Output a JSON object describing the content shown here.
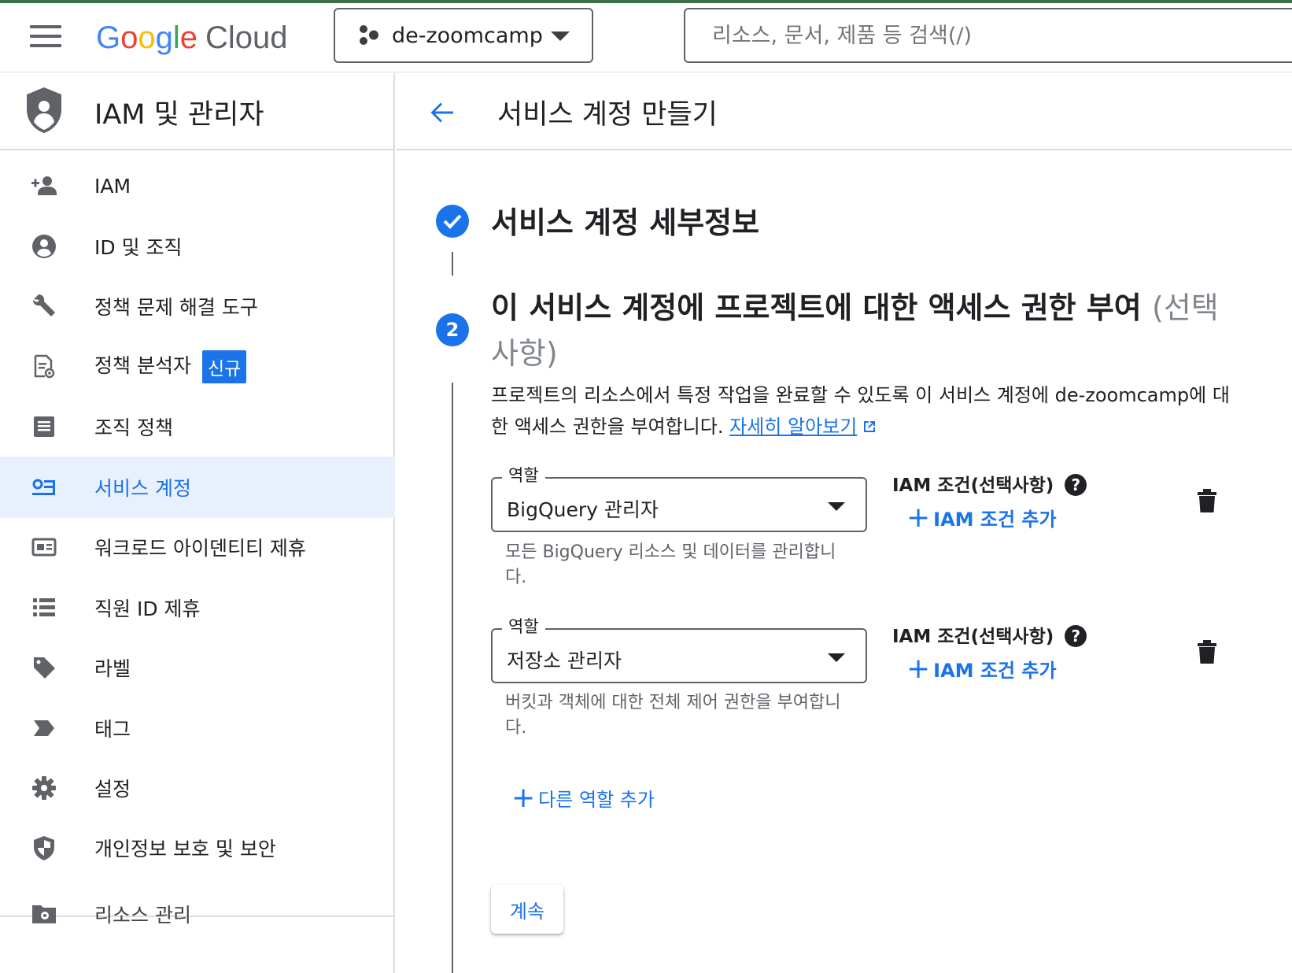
{
  "topbar": {
    "logo": {
      "g1": "G",
      "o1": "o",
      "o2": "o",
      "g2": "g",
      "l": "l",
      "e": "e",
      "cloud": "Cloud"
    },
    "project": "de-zoomcamp",
    "search_placeholder": "리소스, 문서, 제품 등 검색(/)"
  },
  "sidebar": {
    "title": "IAM 및 관리자",
    "items": [
      {
        "label": "IAM",
        "icon": "person-add-icon"
      },
      {
        "label": "ID 및 조직",
        "icon": "account-circle-icon"
      },
      {
        "label": "정책 문제 해결 도구",
        "icon": "wrench-icon"
      },
      {
        "label": "정책 분석자",
        "icon": "policy-document-icon",
        "badge": "신규"
      },
      {
        "label": "조직 정책",
        "icon": "list-document-icon"
      },
      {
        "label": "서비스 계정",
        "icon": "service-account-icon",
        "active": true
      },
      {
        "label": "워크로드 아이덴티티 제휴",
        "icon": "id-card-icon"
      },
      {
        "label": "직원 ID 제휴",
        "icon": "list-icon"
      },
      {
        "label": "라벨",
        "icon": "tag-icon"
      },
      {
        "label": "태그",
        "icon": "chevron-tag-icon"
      },
      {
        "label": "설정",
        "icon": "gear-icon"
      },
      {
        "label": "개인정보 보호 및 보안",
        "icon": "shield-icon"
      },
      {
        "label": "리소스 관리",
        "icon": "folder-gear-icon"
      }
    ]
  },
  "main": {
    "page_title": "서비스 계정 만들기",
    "step1": {
      "title": "서비스 계정 세부정보"
    },
    "step2": {
      "number": "2",
      "title": "이 서비스 계정에 프로젝트에 대한 액세스 권한 부여",
      "optional": "(선택사항)",
      "description": "프로젝트의 리소스에서 특정 작업을 완료할 수 있도록 이 서비스 계정에 de-zoomcamp에 대한 액세스 권한을 부여합니다.",
      "learn_more": "자세히 알아보기"
    },
    "roles": [
      {
        "field_label": "역할",
        "value": "BigQuery 관리자",
        "hint": "모든 BigQuery 리소스 및 데이터를 관리합니다.",
        "condition_label": "IAM 조건(선택사항)",
        "add_condition": "IAM 조건 추가"
      },
      {
        "field_label": "역할",
        "value": "저장소 관리자",
        "hint": "버킷과 객체에 대한 전체 제어 권한을 부여합니다.",
        "condition_label": "IAM 조건(선택사항)",
        "add_condition": "IAM 조건 추가"
      }
    ],
    "help_glyph": "?",
    "plus_glyph": "+",
    "add_role": "다른 역할 추가",
    "continue": "계속"
  },
  "colors": {
    "accent": "#1a73e8",
    "active_bg": "#e8f0fe",
    "icon_gray": "#5f6368"
  }
}
